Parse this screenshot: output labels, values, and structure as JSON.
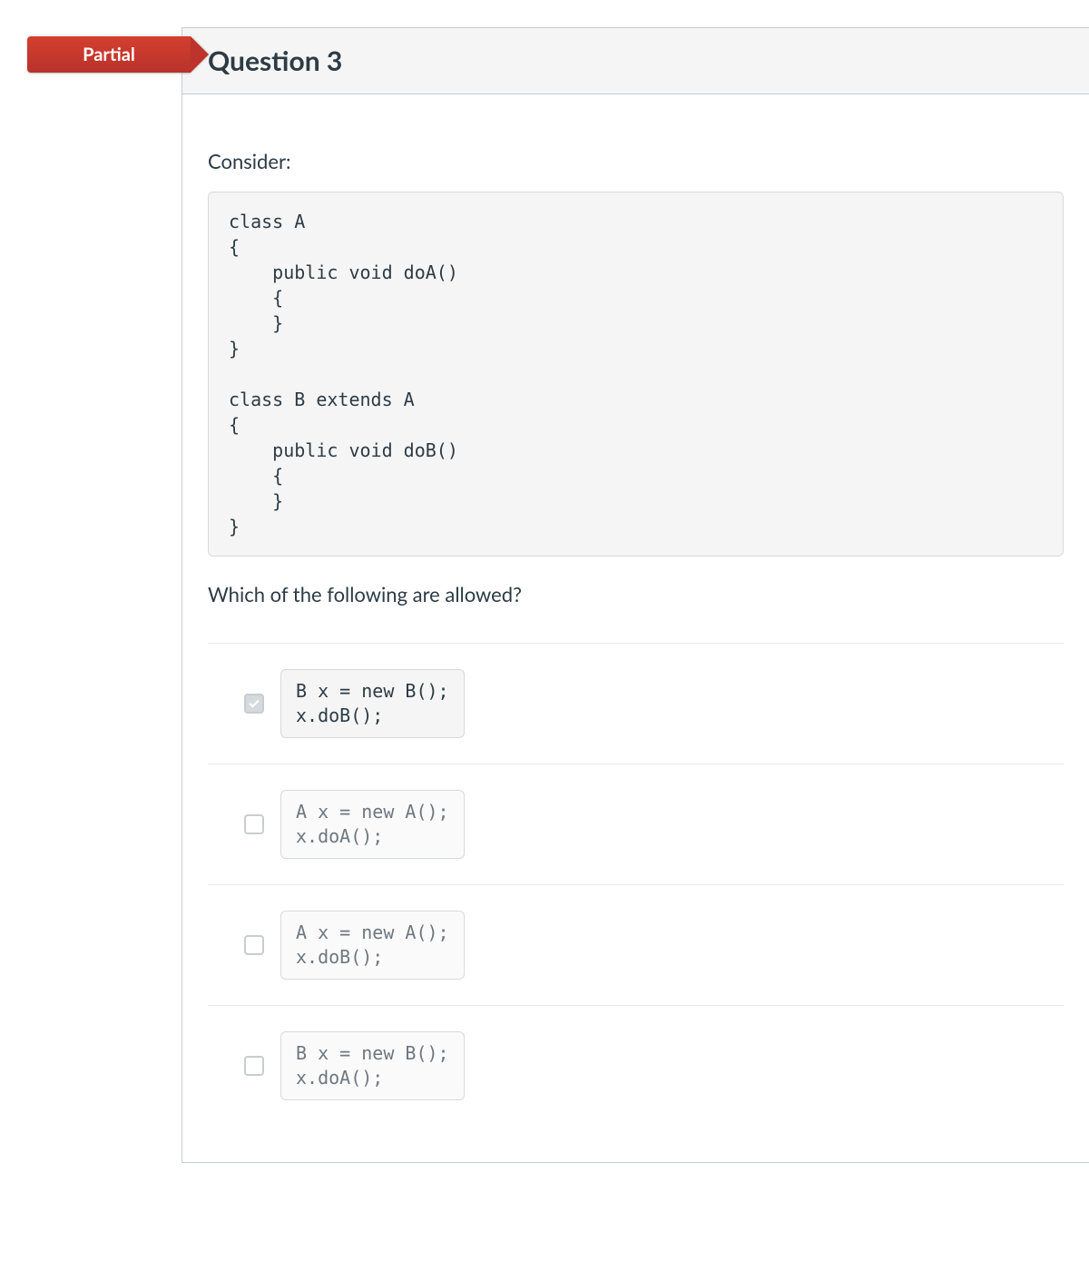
{
  "badge": {
    "label": "Partial"
  },
  "question": {
    "title": "Question 3",
    "prompt_lead": "Consider:",
    "code": "class A\n{\n    public void doA()\n    {\n    }\n}\n\nclass B extends A\n{\n    public void doB()\n    {\n    }\n}",
    "prompt_question": "Which of the following are allowed?",
    "answers": [
      {
        "code": "B x = new B();\nx.doB();",
        "checked": true,
        "selected": true
      },
      {
        "code": "A x = new A();\nx.doA();",
        "checked": false,
        "selected": false
      },
      {
        "code": "A x = new A();\nx.doB();",
        "checked": false,
        "selected": false
      },
      {
        "code": "B x = new B();\nx.doA();",
        "checked": false,
        "selected": false
      }
    ]
  }
}
